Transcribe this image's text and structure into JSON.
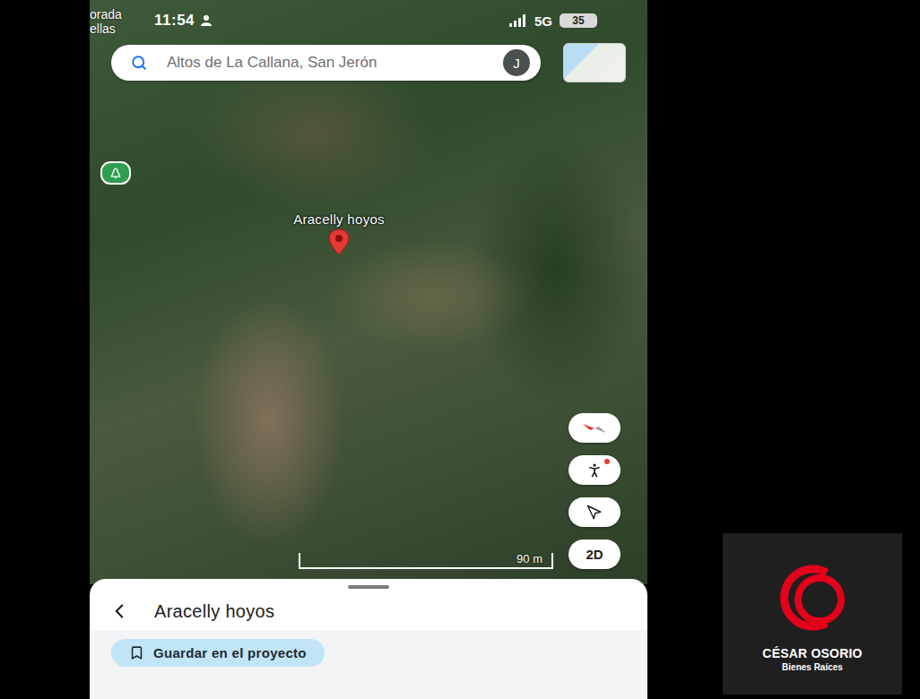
{
  "status_bar": {
    "time": "11:54",
    "network": "5G",
    "battery": "35"
  },
  "map_labels": [
    "orada",
    "ellas"
  ],
  "search": {
    "value": "Altos de La Callana, San Jerón",
    "avatar": "J"
  },
  "pin": {
    "label": "Aracelly hoyos"
  },
  "map_controls": [
    {
      "kind": "compass"
    },
    {
      "kind": "pegman"
    },
    {
      "kind": "locate"
    },
    {
      "kind": "text",
      "label": "2D"
    }
  ],
  "scale": {
    "label": "90 m"
  },
  "sheet": {
    "title": "Aracelly hoyos",
    "action": "Guardar en el proyecto"
  },
  "logo": {
    "name": "CÉSAR OSORIO",
    "tagline": "Bienes Raíces"
  }
}
